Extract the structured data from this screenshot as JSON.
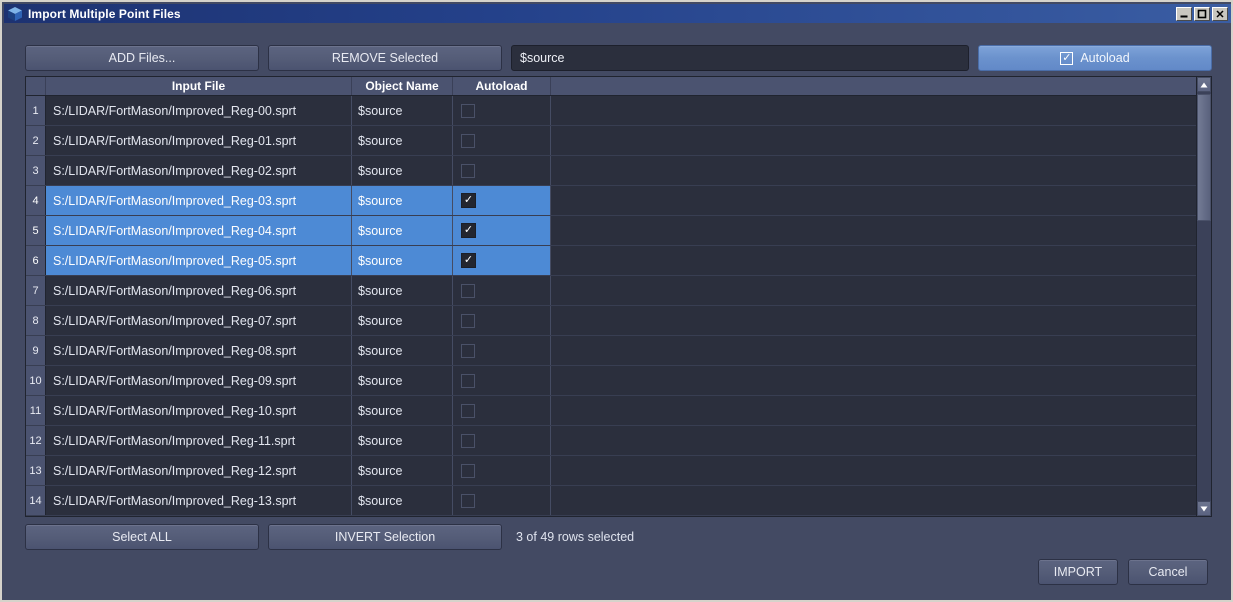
{
  "window": {
    "title": "Import Multiple Point Files",
    "icon": "cube-icon",
    "controls": {
      "minimize": "minimize-icon",
      "maximize": "maximize-icon",
      "close": "close-icon"
    }
  },
  "toolbar": {
    "add_files_label": "ADD Files...",
    "remove_selected_label": "REMOVE Selected",
    "object_name_value": "$source",
    "object_name_placeholder": "",
    "autoload_label": "Autoload",
    "autoload_checked": true,
    "autoload_check_glyph": "✓"
  },
  "table": {
    "columns": [
      "Input File",
      "Object Name",
      "Autoload"
    ],
    "check_glyph": "✓",
    "rows": [
      {
        "num": "1",
        "file": "S:/LIDAR/FortMason/Improved_Reg-00.sprt",
        "object": "$source",
        "autoload": false,
        "selected": false
      },
      {
        "num": "2",
        "file": "S:/LIDAR/FortMason/Improved_Reg-01.sprt",
        "object": "$source",
        "autoload": false,
        "selected": false
      },
      {
        "num": "3",
        "file": "S:/LIDAR/FortMason/Improved_Reg-02.sprt",
        "object": "$source",
        "autoload": false,
        "selected": false
      },
      {
        "num": "4",
        "file": "S:/LIDAR/FortMason/Improved_Reg-03.sprt",
        "object": "$source",
        "autoload": true,
        "selected": true
      },
      {
        "num": "5",
        "file": "S:/LIDAR/FortMason/Improved_Reg-04.sprt",
        "object": "$source",
        "autoload": true,
        "selected": true
      },
      {
        "num": "6",
        "file": "S:/LIDAR/FortMason/Improved_Reg-05.sprt",
        "object": "$source",
        "autoload": true,
        "selected": true
      },
      {
        "num": "7",
        "file": "S:/LIDAR/FortMason/Improved_Reg-06.sprt",
        "object": "$source",
        "autoload": false,
        "selected": false
      },
      {
        "num": "8",
        "file": "S:/LIDAR/FortMason/Improved_Reg-07.sprt",
        "object": "$source",
        "autoload": false,
        "selected": false
      },
      {
        "num": "9",
        "file": "S:/LIDAR/FortMason/Improved_Reg-08.sprt",
        "object": "$source",
        "autoload": false,
        "selected": false
      },
      {
        "num": "10",
        "file": "S:/LIDAR/FortMason/Improved_Reg-09.sprt",
        "object": "$source",
        "autoload": false,
        "selected": false
      },
      {
        "num": "11",
        "file": "S:/LIDAR/FortMason/Improved_Reg-10.sprt",
        "object": "$source",
        "autoload": false,
        "selected": false
      },
      {
        "num": "12",
        "file": "S:/LIDAR/FortMason/Improved_Reg-11.sprt",
        "object": "$source",
        "autoload": false,
        "selected": false
      },
      {
        "num": "13",
        "file": "S:/LIDAR/FortMason/Improved_Reg-12.sprt",
        "object": "$source",
        "autoload": false,
        "selected": false
      },
      {
        "num": "14",
        "file": "S:/LIDAR/FortMason/Improved_Reg-13.sprt",
        "object": "$source",
        "autoload": false,
        "selected": false
      }
    ]
  },
  "bottom": {
    "select_all_label": "Select ALL",
    "invert_selection_label": "INVERT Selection",
    "status": "3 of 49 rows selected"
  },
  "actions": {
    "import_label": "IMPORT",
    "cancel_label": "Cancel"
  },
  "colors": {
    "selection_blue": "#4d8ad5",
    "accent_button_blue": "#6b92cd",
    "panel_bg": "#434a63",
    "table_bg": "#2b2f3d",
    "header_bg": "#4b5370",
    "titlebar_start": "#1d3271",
    "titlebar_end": "#3a5da3"
  }
}
